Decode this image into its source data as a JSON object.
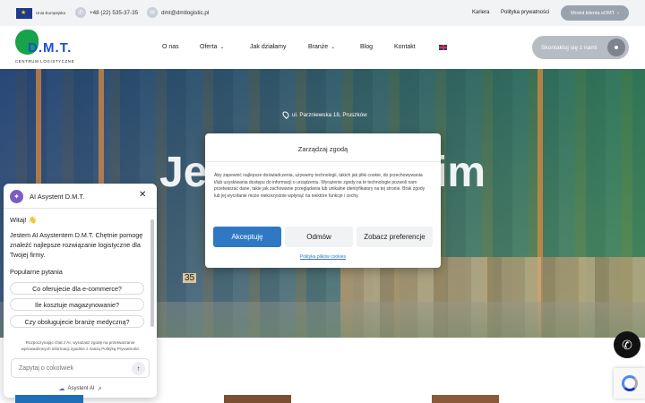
{
  "topbar": {
    "eu_label": "Unia Europejska",
    "phone": "+48 (22) 535-37-35",
    "email": "dmt@dmtlogistic.pl",
    "links": [
      "Kariera",
      "Polityka prywatności"
    ],
    "client_button": "Moduł klienta eDMT"
  },
  "logo": {
    "name": "D.M.T.",
    "subtitle": "CENTRUM LOGISTYCZNE"
  },
  "nav": {
    "items": [
      {
        "label": "O nas"
      },
      {
        "label": "Oferta"
      },
      {
        "label": "Jak działamy"
      },
      {
        "label": "Branże"
      },
      {
        "label": "Blog"
      },
      {
        "label": "Kontakt"
      }
    ],
    "cta": "Skontaktuj się z nami"
  },
  "hero": {
    "address": "ul. Parzniewska 18, Pruszków",
    "title_left": "Je",
    "title_right": "im",
    "box_number": "35"
  },
  "cookie": {
    "title": "Zarządzaj zgodą",
    "text": "Aby zapewnić najlepsze doświadczenia, używamy technologii, takich jak pliki cookie, do przechowywania i/lub uzyskiwania dostępu do informacji o urządzeniu. Wyrażenie zgody na te technologie pozwoli nam przetwarzać dane, takie jak zachowanie przeglądania lub unikalne identyfikatory na tej stronie. Brak zgody lub jej wycofanie może niekorzystnie wpłynąć na niektóre funkcje i cechy.",
    "accept": "Akceptuję",
    "deny": "Odmów",
    "preferences": "Zobacz preferencje",
    "policy_link": "Polityka plików cookies"
  },
  "chat": {
    "title": "AI Asystent D.M.T.",
    "greeting": "Witaj! 👋",
    "message": "Jestem AI Asystentem D.M.T. Chętnie pomogę znaleźć najlepsze rozwiązanie logistyczne dla Twojej firmy.",
    "popular_label": "Popularne pytania",
    "questions": [
      "Co oferujecie dla e-commerce?",
      "Ile kosztuje magazynowanie?",
      "Czy obsługujecie branżę medyczną?"
    ],
    "consent": "Rozpoczynając chat z AI, wyrażasz zgodę na przetwarzanie wprowadzonych informacji zgodnie z naszą Polityką Prywatności",
    "input_placeholder": "Zapytaj o cokolwiek",
    "brand": "Asystent AI"
  },
  "colors": {
    "accent_blue": "#2f78c4",
    "brand_green": "#16a34a",
    "brand_blue": "#1d4ed8",
    "chat_purple": "#7c5cc4"
  }
}
